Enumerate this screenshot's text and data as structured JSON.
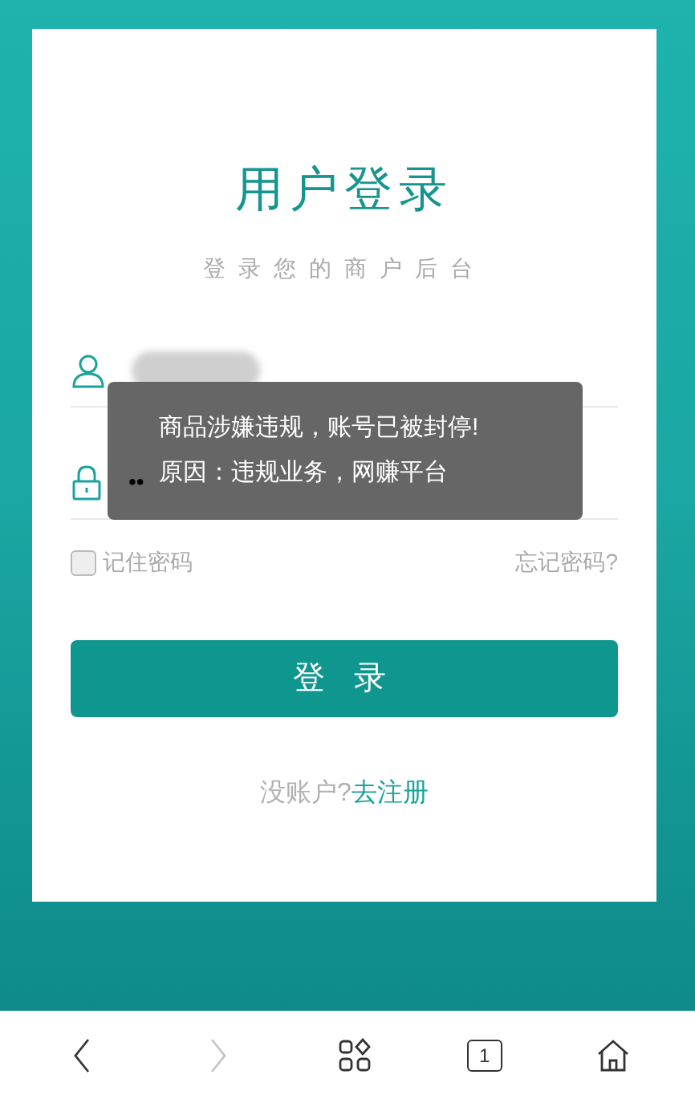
{
  "login": {
    "title": "用户登录",
    "subtitle": "登录您的商户后台",
    "username": {
      "redacted": true
    },
    "password": {
      "value": "••"
    },
    "remember": {
      "label": "记住密码",
      "checked": false
    },
    "forgot": "忘记密码?",
    "submit": "登 录",
    "signup_prompt": "没账户?",
    "signup_link": "去注册"
  },
  "toast": {
    "lines": [
      "商品涉嫌违规，账号已被封停!",
      "原因：违规业务，网赚平台"
    ]
  },
  "browser_bar": {
    "back_disabled": false,
    "forward_disabled": true,
    "tab_count": "1"
  }
}
